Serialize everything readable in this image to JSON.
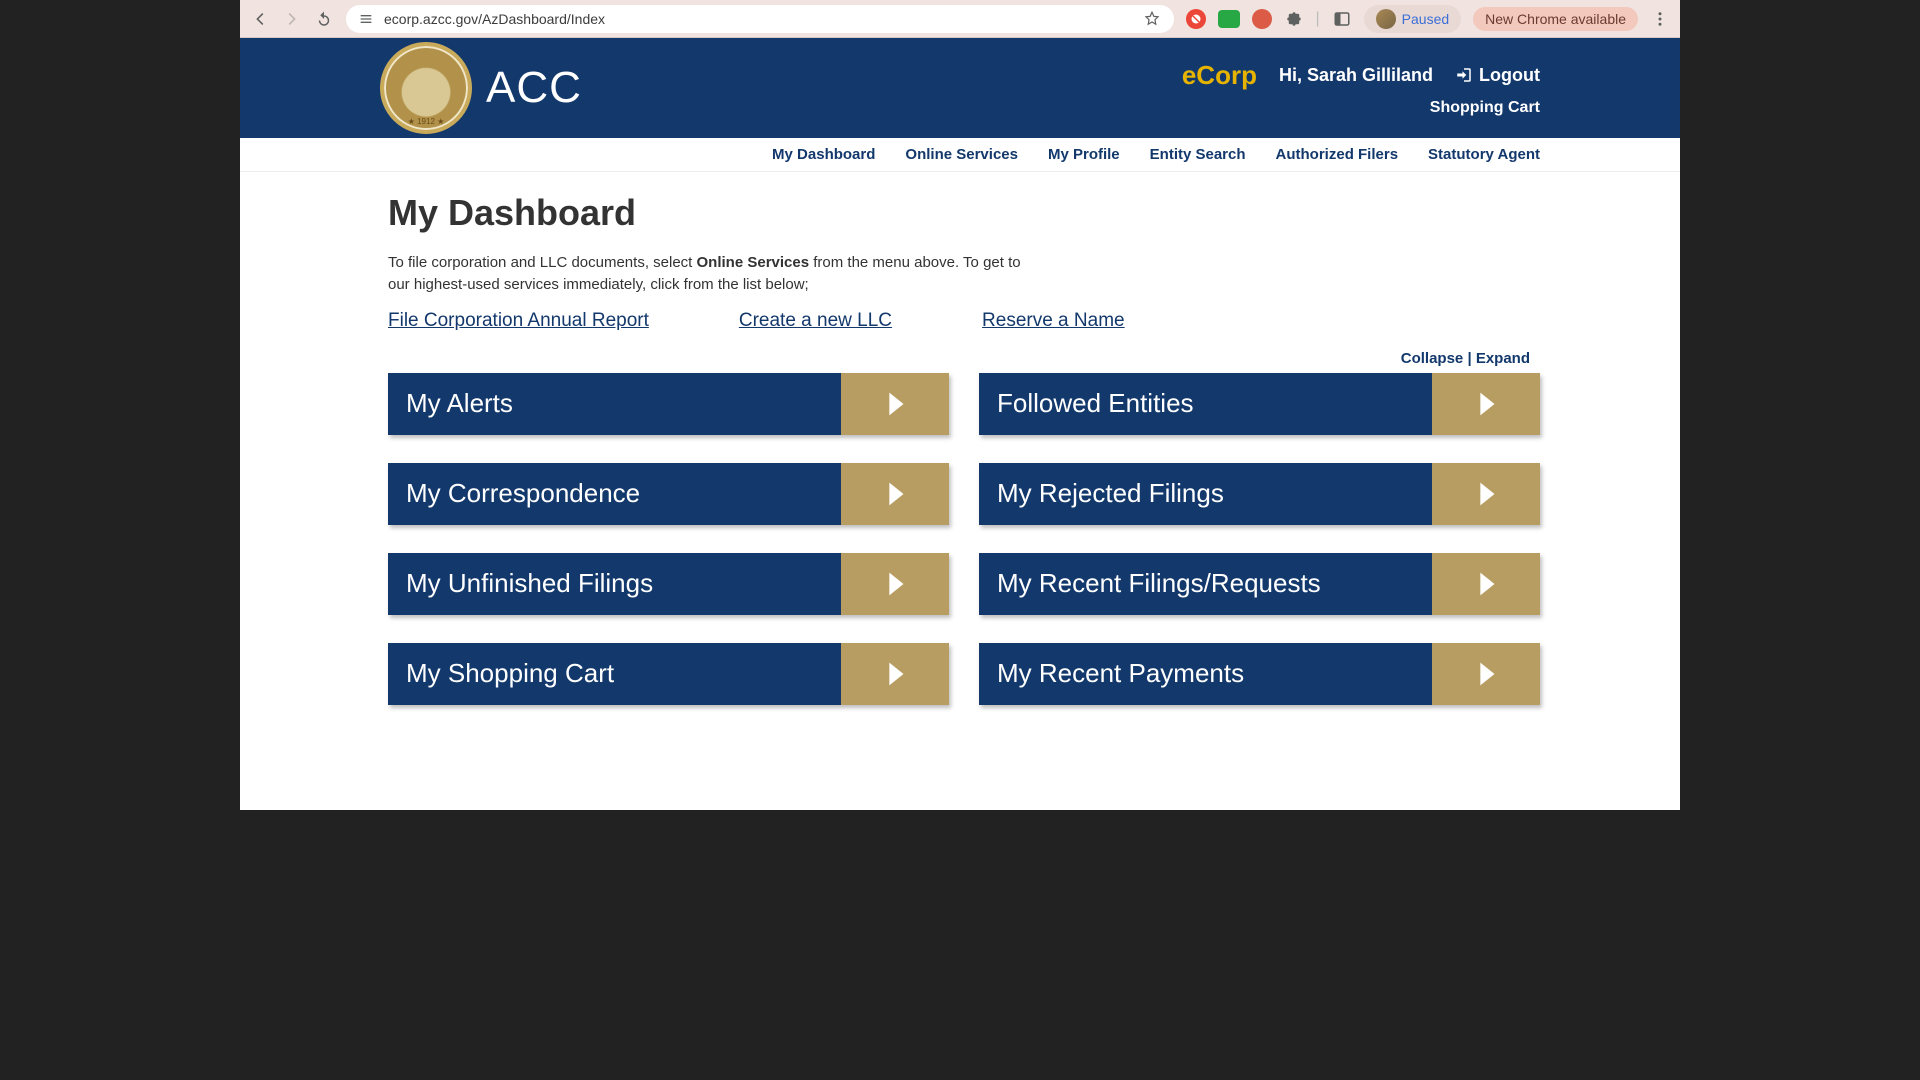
{
  "browser": {
    "url": "ecorp.azcc.gov/AzDashboard/Index",
    "paused_label": "Paused",
    "update_label": "New Chrome available"
  },
  "header": {
    "brand_short": "ACC",
    "ecorp": "eCorp",
    "greeting": "Hi, Sarah Gilliland",
    "logout": "Logout",
    "shopping_cart": "Shopping Cart"
  },
  "nav": {
    "items": [
      "My Dashboard",
      "Online Services",
      "My Profile",
      "Entity Search",
      "Authorized Filers",
      "Statutory Agent"
    ]
  },
  "page": {
    "title": "My Dashboard",
    "intro_pre": "To file corporation and LLC documents, select ",
    "intro_bold": "Online Services",
    "intro_post": " from the menu above. To get to our highest-used services immediately, click from the list below;",
    "quick_links": [
      "File Corporation Annual Report",
      "Create a new LLC",
      "Reserve a Name"
    ],
    "collapse": "Collapse",
    "expand": "Expand",
    "panels": {
      "left": [
        "My Alerts",
        "My Correspondence",
        "My Unfinished Filings",
        "My Shopping Cart"
      ],
      "right": [
        "Followed Entities",
        "My Rejected Filings",
        "My Recent Filings/Requests",
        "My Recent Payments"
      ]
    }
  }
}
